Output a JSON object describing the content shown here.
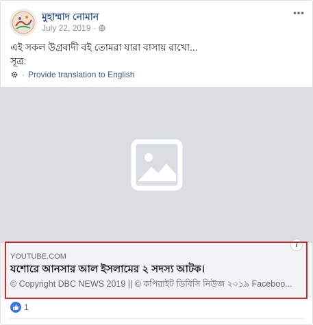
{
  "post": {
    "author_name": "মুহাম্মাদ নোমান",
    "date": "July 22, 2019",
    "separator": "·",
    "text_line1": "এই সকল উগ্রবাদী বই তোমরা যারা বাসায় রাখো...",
    "text_line2": "সূত্র:",
    "translate_dot": "·",
    "translate_label": "Provide translation to English",
    "privacy_icon": "globe-icon",
    "more_icon": "more-horizontal-icon"
  },
  "link_preview": {
    "domain": "YOUTUBE.COM",
    "title": "যশোরে আনসার আল ইসলামের ২ সদস্য আটক।",
    "description": "© Copyright DBC NEWS 2019 || © কপিরাইট ডিবিসি নিউজ ২০১৯ Faceboo...",
    "info_label": "i",
    "placeholder_icon": "image-placeholder-icon"
  },
  "reactions": {
    "like_count": "1",
    "icon": "thumbs-up-icon"
  },
  "colors": {
    "link_blue": "#385898",
    "highlight_red": "#d9252b",
    "media_gray": "#dadde1",
    "like_blue": "#3578e5"
  }
}
